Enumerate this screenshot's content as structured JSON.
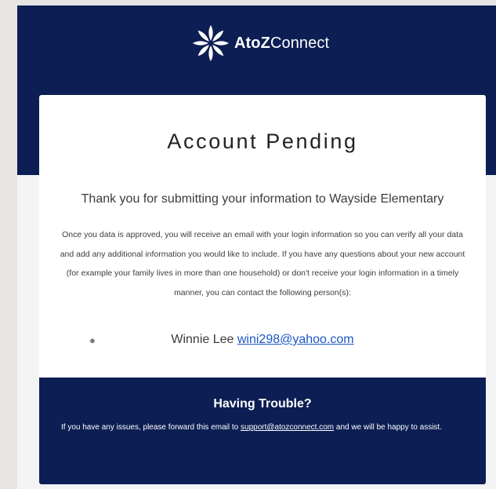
{
  "header": {
    "logo_icon": "flower-logo-icon",
    "brand_bold": "AtoZ",
    "brand_regular": "Connect",
    "colors": {
      "band": "#0c1e53",
      "text": "#ffffff"
    }
  },
  "card": {
    "title": "Account Pending",
    "thanks": "Thank you for submitting your information to Wayside Elementary",
    "body": "Once you data is approved, you will receive an email with your login information so you can verify all your data and add any additional information you would like to include. If you have any questions about your new account (for example your family lives in more than one household) or don't receive your login information in a timely manner, you can contact the following person(s):",
    "contacts": [
      {
        "name": "Winnie Lee",
        "email": "wini298@yahoo.com"
      }
    ]
  },
  "footer": {
    "title": "Having Trouble?",
    "text_before": "If you have any issues, please forward this email to ",
    "support_email": "support@atozconnect.com",
    "text_after": " and we will be happy to assist.",
    "colors": {
      "background": "#0c1e53",
      "link": "#1a56c4"
    }
  }
}
